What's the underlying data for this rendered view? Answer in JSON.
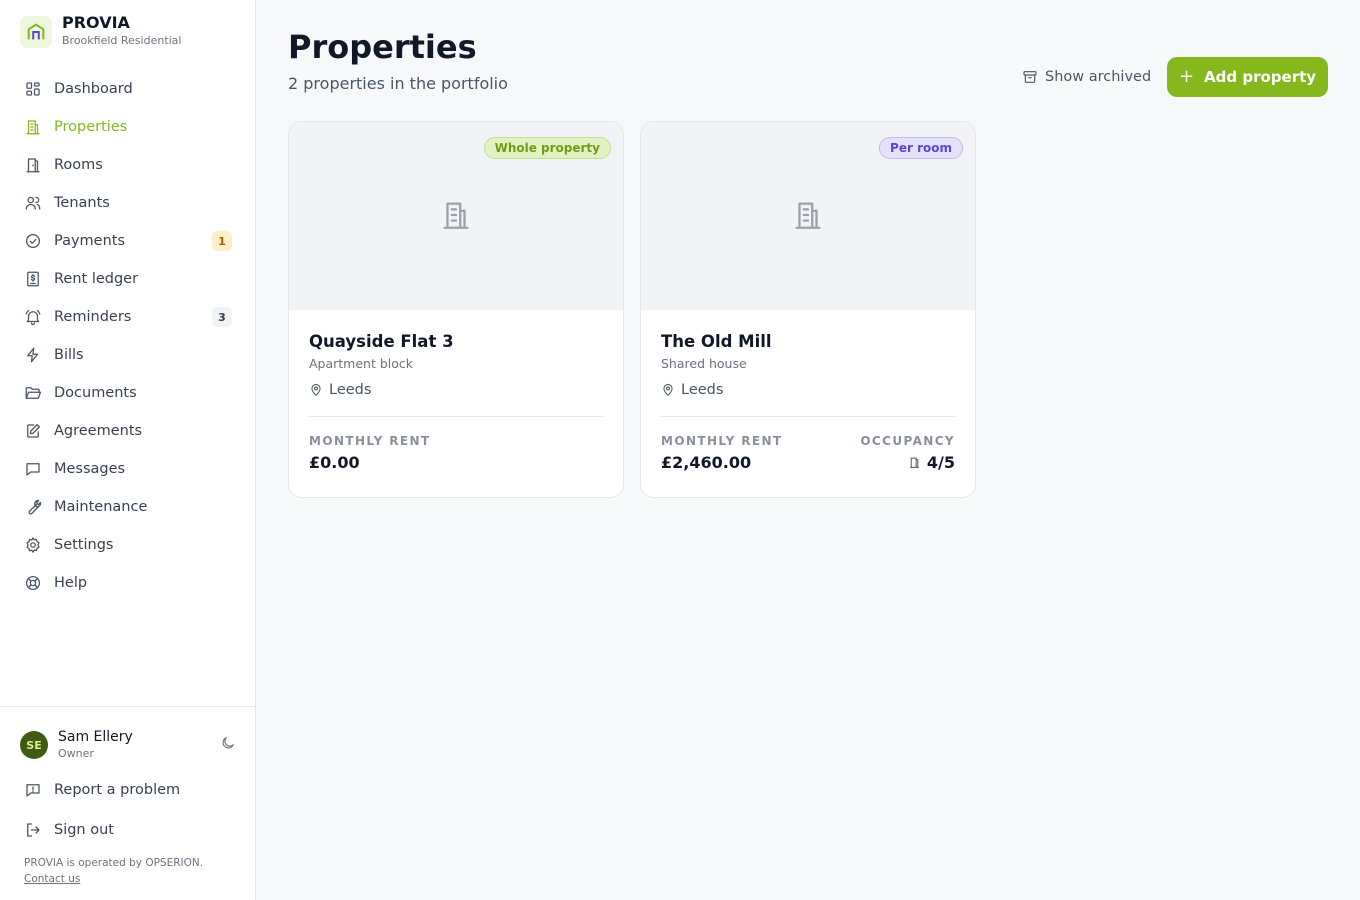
{
  "brand": {
    "name": "PROVIA",
    "subtitle": "Brookfield Residential"
  },
  "sidebar": {
    "items": [
      {
        "label": "Dashboard",
        "icon": "grid-icon"
      },
      {
        "label": "Properties",
        "icon": "building-icon",
        "active": true
      },
      {
        "label": "Rooms",
        "icon": "door-icon"
      },
      {
        "label": "Tenants",
        "icon": "users-icon"
      },
      {
        "label": "Payments",
        "icon": "check-circle-icon",
        "badge": "1"
      },
      {
        "label": "Rent ledger",
        "icon": "ledger-icon"
      },
      {
        "label": "Reminders",
        "icon": "bell-icon",
        "badge": "3"
      },
      {
        "label": "Bills",
        "icon": "lightning-icon"
      },
      {
        "label": "Documents",
        "icon": "folder-icon"
      },
      {
        "label": "Agreements",
        "icon": "edit-document-icon"
      },
      {
        "label": "Messages",
        "icon": "message-icon"
      },
      {
        "label": "Maintenance",
        "icon": "wrench-icon"
      },
      {
        "label": "Settings",
        "icon": "gear-icon"
      },
      {
        "label": "Help",
        "icon": "lifebuoy-icon"
      }
    ]
  },
  "user": {
    "initials": "SE",
    "name": "Sam Ellery",
    "role": "Owner"
  },
  "footer": {
    "report": "Report a problem",
    "signout": "Sign out",
    "note": "PROVIA is operated by OPSERION.",
    "contact": "Contact us"
  },
  "main": {
    "title": "Properties",
    "subtitle": "2 properties in the portfolio",
    "show_archived": "Show archived",
    "add_property": "Add property"
  },
  "properties": [
    {
      "tag": "Whole property",
      "name": "Quayside Flat 3",
      "type": "Apartment block",
      "location": "Leeds",
      "rent_label": "MONTHLY RENT",
      "rent": "£0.00"
    },
    {
      "tag": "Per room",
      "name": "The Old Mill",
      "type": "Shared house",
      "location": "Leeds",
      "rent_label": "MONTHLY RENT",
      "rent": "£2,460.00",
      "occupancy_label": "OCCUPANCY",
      "occupancy": "4/5"
    }
  ],
  "colors": {
    "accent": "#84b81d",
    "badge_amber": "#fdf0c8",
    "tag_purple": "#5b45d6"
  }
}
